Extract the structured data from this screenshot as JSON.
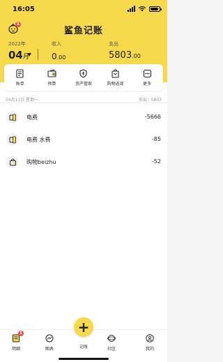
{
  "status_bar": {
    "time": "16:05"
  },
  "header": {
    "title": "鲨鱼记账",
    "badge_count": "1",
    "year_label": "2022年",
    "month_value": "04",
    "month_unit": "月",
    "income_label": "收入",
    "income_int": "0",
    "income_dec": ".00",
    "expense_label": "支出",
    "expense_int": "5803",
    "expense_dec": ".00"
  },
  "quick_actions": [
    {
      "label": "账单",
      "icon": "bill-icon"
    },
    {
      "label": "预算",
      "icon": "wallet-icon"
    },
    {
      "label": "资产管家",
      "icon": "shield-icon"
    },
    {
      "label": "购物返现",
      "icon": "cart-icon"
    },
    {
      "label": "更多",
      "icon": "more-icon"
    }
  ],
  "day_group": {
    "date": "04月11日  星期一",
    "total": "支出：5803"
  },
  "records": [
    {
      "name": "电费",
      "amount": "-5666",
      "icon": "electricity-icon"
    },
    {
      "name": "电费 水费",
      "amount": "-85",
      "icon": "electricity-icon"
    },
    {
      "name": "购物beizhu",
      "amount": "-52",
      "icon": "shopping-bag-icon"
    }
  ],
  "nav": {
    "items": [
      {
        "label": "明细",
        "icon": "detail-icon",
        "badge": "1"
      },
      {
        "label": "图表",
        "icon": "chart-icon"
      },
      {
        "label": "记账",
        "icon": "add-icon"
      },
      {
        "label": "社区",
        "icon": "community-icon"
      },
      {
        "label": "我的",
        "icon": "profile-icon"
      }
    ]
  },
  "colors": {
    "accent": "#f7d94c",
    "badge": "#f05252",
    "muted": "#999999"
  }
}
